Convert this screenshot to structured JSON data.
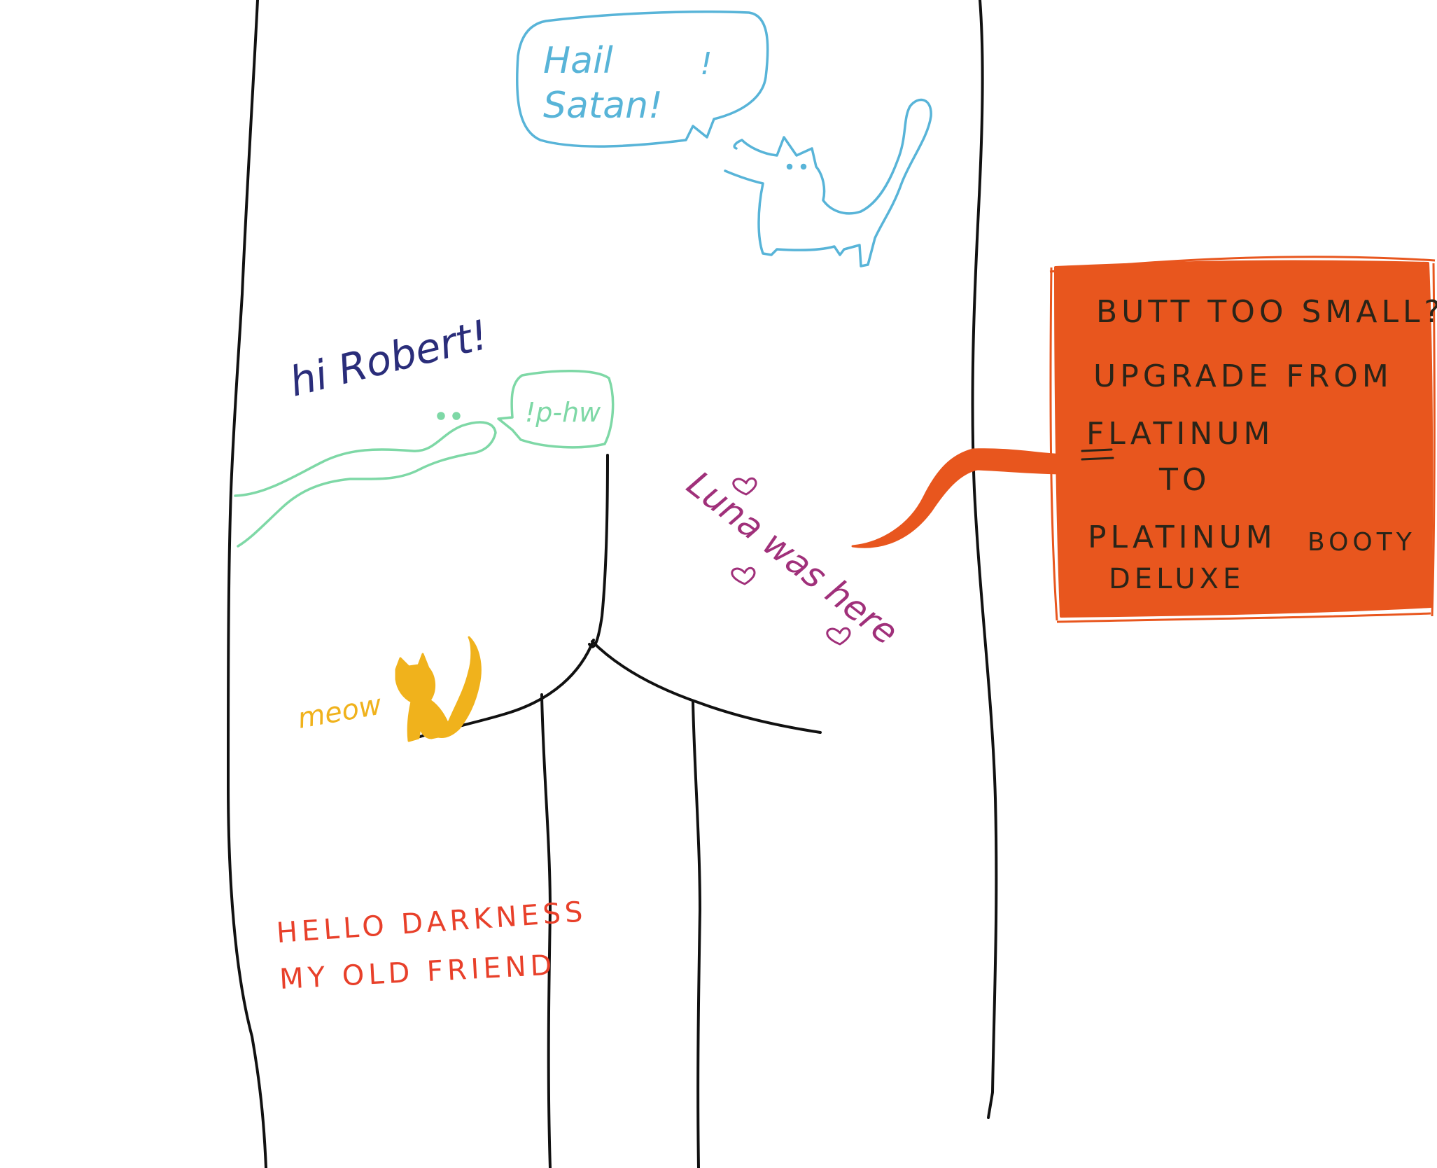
{
  "drawing": {
    "colors": {
      "outline": "#111111",
      "blue_doodle": "#58b4d8",
      "green_doodle": "#7ed8a6",
      "navy_text": "#2a2d7a",
      "purple_text": "#a0307a",
      "orange_cat": "#f0b21c",
      "red_text": "#e8402a",
      "ad_fill": "#e8561e",
      "ad_text": "#2a2418"
    },
    "cat_speech": {
      "line1": "Hail",
      "line2": "Satan!",
      "exclaim": "!"
    },
    "greeting": "hi Robert!",
    "snake_speech": "!p-hw",
    "luna_note": "Luna was here",
    "meow_label": "meow",
    "lyrics": {
      "line1": "HELLO DARKNESS",
      "line2": "MY OLD FRIEND"
    },
    "ad": {
      "line1": "BUTT TOO SMALL?",
      "line2": "UPGRADE FROM",
      "line3": "FLATINUM",
      "line4": "TO",
      "line5": "PLATINUM",
      "line5b": "BOOTY",
      "line6": "DELUXE"
    },
    "icons": {
      "cat_blue": "cat-icon",
      "snake": "snake-icon",
      "cat_orange": "cat-icon",
      "heart": "heart-icon"
    }
  }
}
